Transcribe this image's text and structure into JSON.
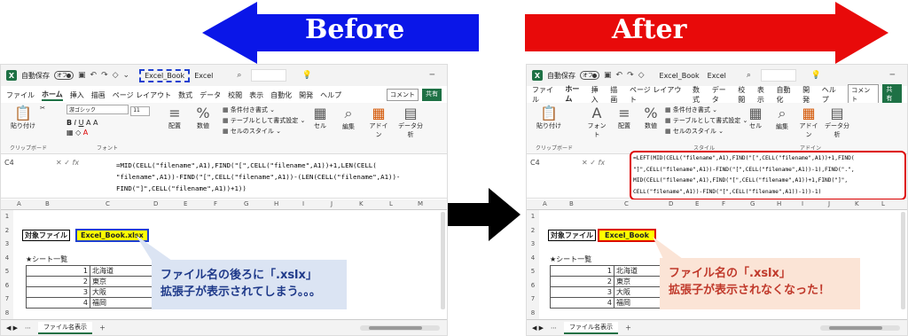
{
  "before_label": "Before",
  "after_label": "After",
  "excel": {
    "autosave": "自動保存",
    "toggle": "オフ",
    "filename": "Excel_Book",
    "app": "Excel",
    "menu": [
      "ファイル",
      "ホーム",
      "挿入",
      "描画",
      "ページ レイアウト",
      "数式",
      "データ",
      "校閲",
      "表示",
      "自動化",
      "開発",
      "ヘルプ"
    ],
    "comment_btn": "コメント",
    "share_btn": "共有",
    "clipboard": "貼り付け",
    "clipboard_group": "クリップボード",
    "font_name": "游ゴシック",
    "font_size": "11",
    "font_group": "フォント",
    "align": "配置",
    "number": "数値",
    "cond_format": "条件付き書式",
    "table_format": "テーブルとして書式設定",
    "cell_style": "セルのスタイル",
    "style_group": "スタイル",
    "cells": "セル",
    "edit": "編集",
    "addin": "アドイン",
    "analyze": "データ分析",
    "addin_group": "アドイン",
    "cell_ref": "C4",
    "fx": "fx",
    "sheet_tab": "ファイル名表示"
  },
  "before": {
    "formula": "=MID(CELL(\"filename\",A1),FIND(\"[\",CELL(\"filename\",A1))+1,LEN(CELL(\n\"filename\",A1))-FIND(\"[\",CELL(\"filename\",A1))-(LEN(CELL(\"filename\",A1))-\nFIND(\"]\",CELL(\"filename\",A1))+1))",
    "label_target": "対象ファイル",
    "value": "Excel_Book.xlsx",
    "sheet_list": "★シート一覧",
    "rows": [
      {
        "n": "1",
        "name": "北海道"
      },
      {
        "n": "2",
        "name": "東京"
      },
      {
        "n": "3",
        "name": "大阪"
      },
      {
        "n": "4",
        "name": "福岡"
      }
    ],
    "callout1": "ファイル名の後ろに「.xslx」",
    "callout2": "拡張子が表示されてしまう。。。"
  },
  "after": {
    "formula": "=LEFT(MID(CELL(\"filename\",A1),FIND(\"[\",CELL(\"filename\",A1))+1,FIND(\n\"]\",CELL(\"filename\",A1))-FIND(\"[\",CELL(\"filename\",A1))-1),FIND(\".\",\nMID(CELL(\"filename\",A1),FIND(\"[\",CELL(\"filename\",A1))+1,FIND(\"]\",\nCELL(\"filename\",A1))-FIND(\"[\",CELL(\"filename\",A1))-1))-1)",
    "label_target": "対象ファイル",
    "value": "Excel_Book",
    "sheet_list": "★シート一覧",
    "rows": [
      {
        "n": "1",
        "name": "北海道"
      },
      {
        "n": "2",
        "name": "東京"
      },
      {
        "n": "3",
        "name": "大阪"
      },
      {
        "n": "4",
        "name": "福岡"
      }
    ],
    "callout1": "ファイル名の「.xslx」",
    "callout2": "拡張子が表示されなくなった！"
  },
  "colors": {
    "before_arrow": "#0a16e8",
    "after_arrow": "#e80a0a",
    "excel_green": "#1e7145",
    "callout_blue": "#dbe4f3",
    "callout_red": "#fbe4d6"
  }
}
